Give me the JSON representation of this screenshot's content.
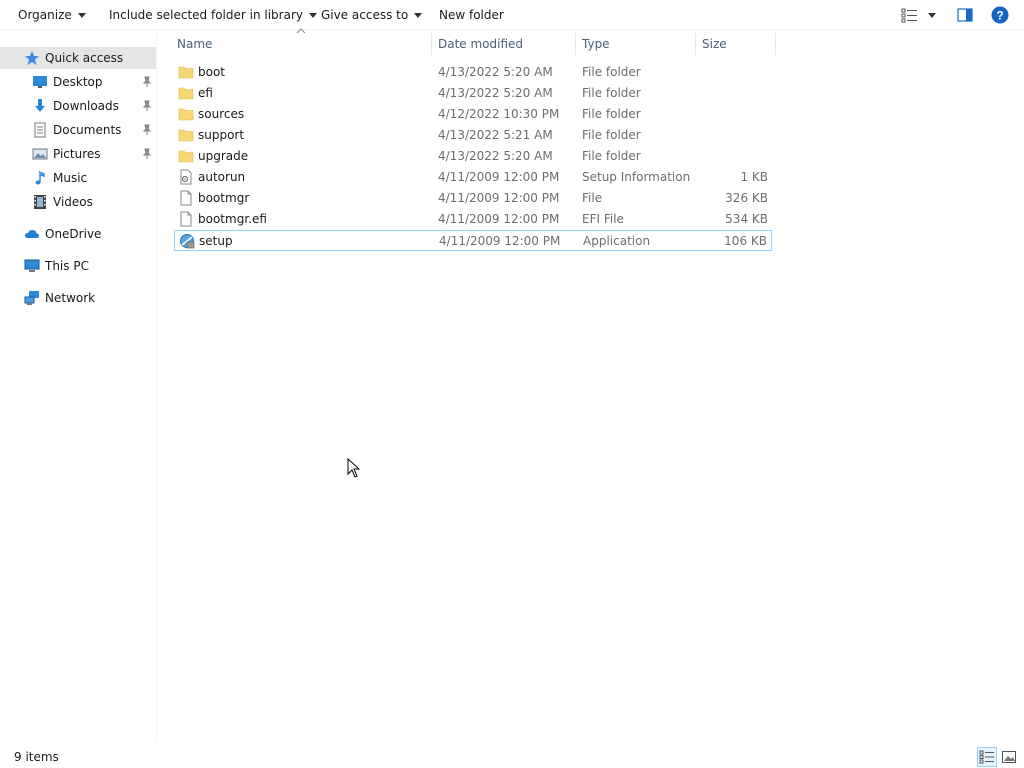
{
  "toolbar": {
    "organize": "Organize",
    "include_library": "Include selected folder in library",
    "give_access": "Give access to",
    "new_folder": "New folder"
  },
  "sidebar": {
    "items": [
      {
        "label": "Quick access",
        "icon": "star-icon",
        "pinned": false
      },
      {
        "label": "Desktop",
        "icon": "desktop-icon",
        "pinned": true
      },
      {
        "label": "Downloads",
        "icon": "download-icon",
        "pinned": true
      },
      {
        "label": "Documents",
        "icon": "documents-icon",
        "pinned": true
      },
      {
        "label": "Pictures",
        "icon": "pictures-icon",
        "pinned": true
      },
      {
        "label": "Music",
        "icon": "music-icon",
        "pinned": false
      },
      {
        "label": "Videos",
        "icon": "videos-icon",
        "pinned": false
      },
      {
        "label": "OneDrive",
        "icon": "cloud-icon",
        "pinned": false
      },
      {
        "label": "This PC",
        "icon": "computer-icon",
        "pinned": false
      },
      {
        "label": "Network",
        "icon": "network-icon",
        "pinned": false
      }
    ]
  },
  "columns": {
    "name": "Name",
    "date": "Date modified",
    "type": "Type",
    "size": "Size"
  },
  "files": [
    {
      "name": "boot",
      "date": "4/13/2022 5:20 AM",
      "type": "File folder",
      "size": "",
      "icon": "folder-icon"
    },
    {
      "name": "efi",
      "date": "4/13/2022 5:20 AM",
      "type": "File folder",
      "size": "",
      "icon": "folder-icon"
    },
    {
      "name": "sources",
      "date": "4/12/2022 10:30 PM",
      "type": "File folder",
      "size": "",
      "icon": "folder-icon"
    },
    {
      "name": "support",
      "date": "4/13/2022 5:21 AM",
      "type": "File folder",
      "size": "",
      "icon": "folder-icon"
    },
    {
      "name": "upgrade",
      "date": "4/13/2022 5:20 AM",
      "type": "File folder",
      "size": "",
      "icon": "folder-icon"
    },
    {
      "name": "autorun",
      "date": "4/11/2009 12:00 PM",
      "type": "Setup Information",
      "size": "1 KB",
      "icon": "settings-file-icon"
    },
    {
      "name": "bootmgr",
      "date": "4/11/2009 12:00 PM",
      "type": "File",
      "size": "326 KB",
      "icon": "file-icon"
    },
    {
      "name": "bootmgr.efi",
      "date": "4/11/2009 12:00 PM",
      "type": "EFI File",
      "size": "534 KB",
      "icon": "file-icon"
    },
    {
      "name": "setup",
      "date": "4/11/2009 12:00 PM",
      "type": "Application",
      "size": "106 KB",
      "icon": "setup-app-icon",
      "focused": true
    }
  ],
  "status": {
    "item_count": "9 items"
  },
  "colors": {
    "accent": "#0078d7",
    "folder": "#f8d775",
    "selection": "#e5e5e5",
    "focus_border": "#99d1ff"
  }
}
